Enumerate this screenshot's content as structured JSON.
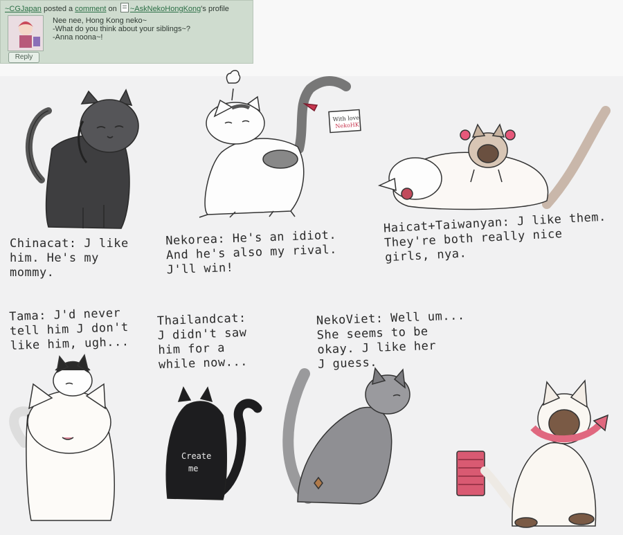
{
  "comment": {
    "author": "~CGJapan",
    "action": "posted a",
    "comment_link": "comment",
    "on": "on",
    "profile_owner": "~AskNekoHongKong",
    "profile_suffix": "'s profile",
    "lines": [
      "Nee nee, Hong Kong neko~",
      "-What do you think about your siblings~?",
      "-Anna noona~!"
    ],
    "reply_label": "Reply"
  },
  "tag_note": [
    "With love",
    "NekoHK"
  ],
  "shirt_text": [
    "Create",
    "me"
  ],
  "captions": {
    "chinacat": "Chinacat: J like\nhim. He's my\nmommy.",
    "nekorea": "Nekorea: He's an idiot.\nAnd he's also my rival.\nJ'll win!",
    "haicat": "Haicat+Taiwanyan: J like them.\nThey're both really nice\ngirls, nya.",
    "tama": "Tama: J'd never\ntell him J don't\nlike him, ugh...",
    "thailandcat": "Thailandcat:\nJ didn't saw\nhim for a\nwhile now...",
    "nekoviet": "NekoViet: Well um...\nShe seems to be\nokay. J like her\nJ guess."
  },
  "colors": {
    "comment_bg": "#cfdccf",
    "link": "#2b6e45",
    "pencil_grey": "#6b6b6e",
    "black_fur": "#1d1d1f",
    "pink": "#e6587a",
    "paper": "#f1f1f2"
  }
}
